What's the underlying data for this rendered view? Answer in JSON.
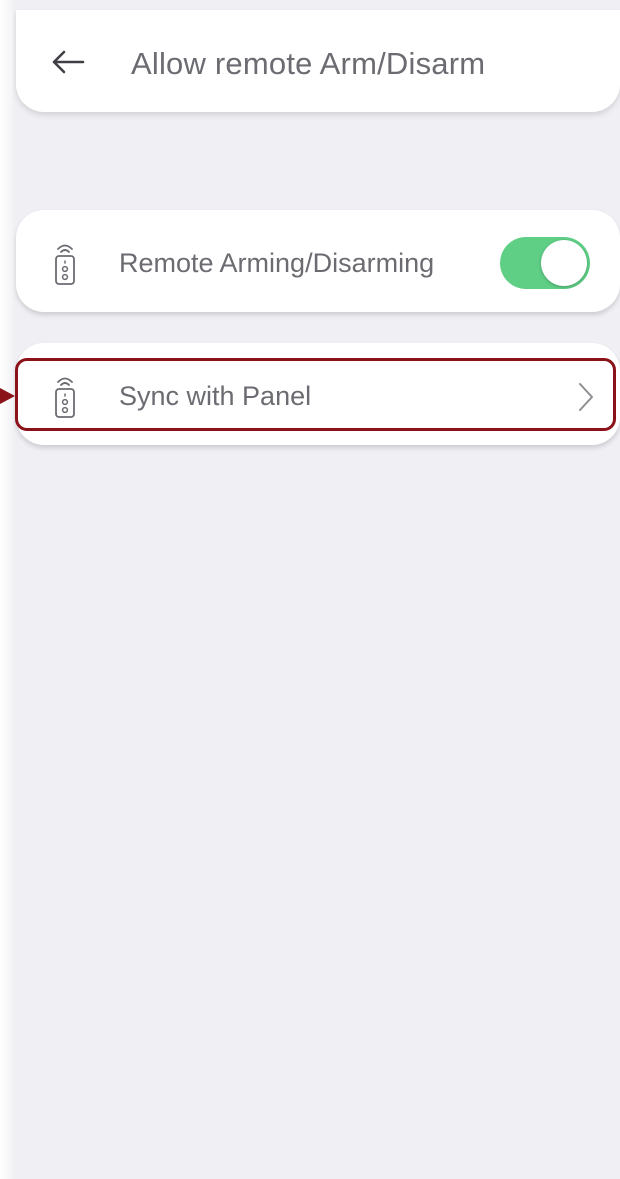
{
  "header": {
    "title": "Allow remote Arm/Disarm",
    "back_icon": "arrow-left-icon"
  },
  "settings": [
    {
      "label": "Remote Arming/Disarming",
      "icon": "remote-control-icon",
      "control": "toggle",
      "enabled": true
    },
    {
      "label": "Sync with Panel",
      "icon": "remote-control-icon",
      "control": "chevron-right-icon"
    }
  ],
  "colors": {
    "background": "#efeff4",
    "card": "#ffffff",
    "text": "#6b6b72",
    "toggle_on": "#5fcf86",
    "highlight": "#8b1219"
  }
}
